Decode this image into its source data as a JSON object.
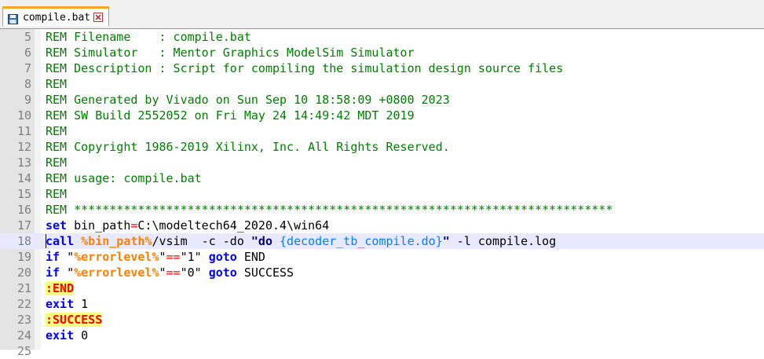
{
  "tab": {
    "filename": "compile.bat",
    "save_icon": "floppy-disk-icon",
    "close_icon": "close-icon"
  },
  "colors": {
    "comment": "#008000",
    "keyword": "#0000ff",
    "operator": "#ff0000",
    "variable": "#ff8000",
    "label_highlight": "#ffff80",
    "current_line": "#e8e8ff"
  },
  "editor": {
    "current_line": 18,
    "lines": [
      {
        "n": "5",
        "tokens": [
          {
            "t": "REM Filename    : compile.bat",
            "c": "comment"
          }
        ]
      },
      {
        "n": "6",
        "tokens": [
          {
            "t": "REM Simulator   : Mentor Graphics ModelSim Simulator",
            "c": "comment"
          }
        ]
      },
      {
        "n": "7",
        "tokens": [
          {
            "t": "REM Description : Script for compiling the simulation design source files",
            "c": "comment"
          }
        ]
      },
      {
        "n": "8",
        "tokens": [
          {
            "t": "REM",
            "c": "comment"
          }
        ]
      },
      {
        "n": "9",
        "tokens": [
          {
            "t": "REM Generated by Vivado on Sun Sep 10 18:58:09 +0800 2023",
            "c": "comment"
          }
        ]
      },
      {
        "n": "10",
        "tokens": [
          {
            "t": "REM SW Build 2552052 on Fri May 24 14:49:42 MDT 2019",
            "c": "comment"
          }
        ]
      },
      {
        "n": "11",
        "tokens": [
          {
            "t": "REM",
            "c": "comment"
          }
        ]
      },
      {
        "n": "12",
        "tokens": [
          {
            "t": "REM Copyright 1986-2019 Xilinx, Inc. All Rights Reserved.",
            "c": "comment"
          }
        ]
      },
      {
        "n": "13",
        "tokens": [
          {
            "t": "REM",
            "c": "comment"
          }
        ]
      },
      {
        "n": "14",
        "tokens": [
          {
            "t": "REM usage: compile.bat",
            "c": "comment"
          }
        ]
      },
      {
        "n": "15",
        "tokens": [
          {
            "t": "REM",
            "c": "comment"
          }
        ]
      },
      {
        "n": "16",
        "tokens": [
          {
            "t": "REM ****************************************************************************",
            "c": "comment"
          }
        ]
      },
      {
        "n": "17",
        "tokens": [
          {
            "t": "set",
            "c": "kw"
          },
          {
            "t": " bin_path",
            "c": "plain"
          },
          {
            "t": "=",
            "c": "op"
          },
          {
            "t": "C:\\modeltech64_2020.4\\win64",
            "c": "plain"
          }
        ]
      },
      {
        "n": "18",
        "tokens": [
          {
            "t": "call",
            "c": "kw"
          },
          {
            "t": " ",
            "c": "plain"
          },
          {
            "t": "%bin_path%",
            "c": "var"
          },
          {
            "t": "/vsim  -c -do ",
            "c": "plain"
          },
          {
            "t": "\"do ",
            "c": "strb"
          },
          {
            "t": "{decoder_tb_compile.do}",
            "c": "subvar"
          },
          {
            "t": "\"",
            "c": "strb"
          },
          {
            "t": " -l compile.log",
            "c": "plain"
          }
        ]
      },
      {
        "n": "19",
        "tokens": [
          {
            "t": "if",
            "c": "kw"
          },
          {
            "t": " \"",
            "c": "plain"
          },
          {
            "t": "%errorlevel%",
            "c": "var"
          },
          {
            "t": "\"",
            "c": "plain"
          },
          {
            "t": "==",
            "c": "op"
          },
          {
            "t": "\"1\" ",
            "c": "plain"
          },
          {
            "t": "goto",
            "c": "kw"
          },
          {
            "t": " END",
            "c": "plain"
          }
        ]
      },
      {
        "n": "20",
        "tokens": [
          {
            "t": "if",
            "c": "kw"
          },
          {
            "t": " \"",
            "c": "plain"
          },
          {
            "t": "%errorlevel%",
            "c": "var"
          },
          {
            "t": "\"",
            "c": "plain"
          },
          {
            "t": "==",
            "c": "op"
          },
          {
            "t": "\"0\" ",
            "c": "plain"
          },
          {
            "t": "goto",
            "c": "kw"
          },
          {
            "t": " SUCCESS",
            "c": "plain"
          }
        ]
      },
      {
        "n": "21",
        "tokens": [
          {
            "t": ":END",
            "c": "label"
          }
        ]
      },
      {
        "n": "22",
        "tokens": [
          {
            "t": "exit",
            "c": "kw"
          },
          {
            "t": " 1",
            "c": "num"
          }
        ]
      },
      {
        "n": "23",
        "tokens": [
          {
            "t": ":SUCCESS",
            "c": "label"
          }
        ]
      },
      {
        "n": "24",
        "tokens": [
          {
            "t": "exit",
            "c": "kw"
          },
          {
            "t": " 0",
            "c": "num"
          }
        ]
      },
      {
        "n": "25",
        "tokens": []
      }
    ]
  }
}
